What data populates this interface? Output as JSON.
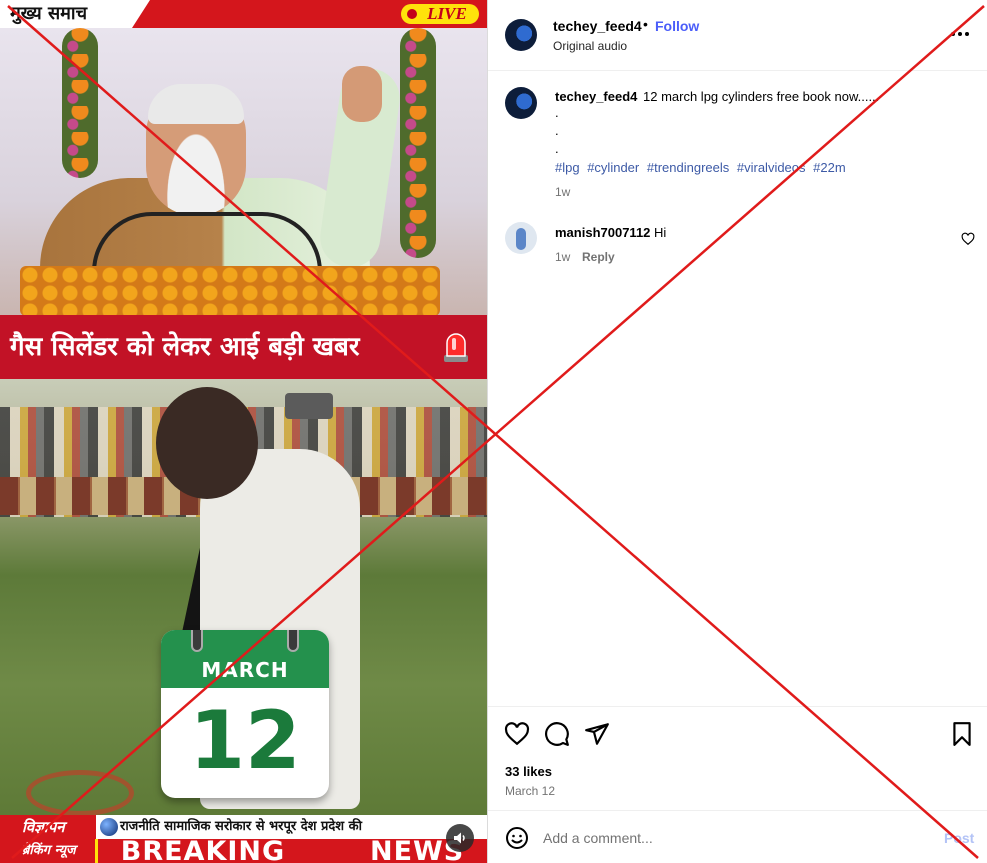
{
  "video": {
    "channel_name": "मुख्य समाच",
    "live_label": "LIVE",
    "headline": "गैस सिलेंडर को लेकर आई बड़ी खबर",
    "calendar_month": "MARCH",
    "calendar_day": "12",
    "ticker_ad_label": "विज्ञापन",
    "ticker_scroll_text": "राजनीति सामाजिक सरोकार से भरपूर  देश प्रदेश की",
    "ticker_left_label": "ब्रेकिंग न्यूज",
    "breaking_word_1": "BREAKING",
    "breaking_word_2": "NEWS",
    "mute_icon": "speaker-icon"
  },
  "post": {
    "username": "techey_feed4",
    "separator": "•",
    "follow_label": "Follow",
    "audio_label": "Original audio",
    "caption_text": "12 march lpg cylinders free book now......",
    "caption_dots": [
      ".",
      ".",
      "."
    ],
    "hashtags": [
      "#lpg",
      "#cylinder",
      "#trendingreels",
      "#viralvideos",
      "#22m"
    ],
    "caption_time": "1w"
  },
  "comments": [
    {
      "username": "manish7007112",
      "text": "Hi",
      "time": "1w",
      "reply_label": "Reply"
    }
  ],
  "engagement": {
    "likes": "33 likes",
    "date": "March 12"
  },
  "composer": {
    "placeholder": "Add a comment...",
    "post_label": "Post"
  },
  "colors": {
    "link_blue": "#4a5df9",
    "hashtag_blue": "#3d5aa6",
    "overlay_red": "#e01b1b",
    "news_red": "#d4161c",
    "calendar_green": "#24914d"
  }
}
